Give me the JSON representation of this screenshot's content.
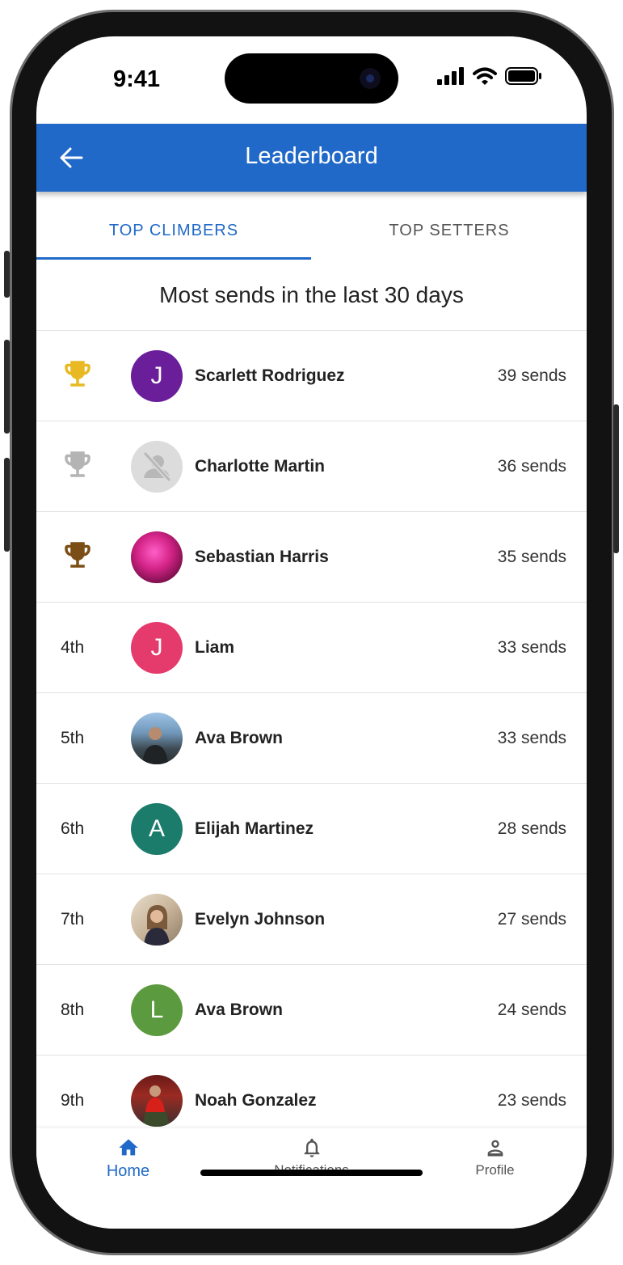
{
  "status_bar": {
    "time": "9:41"
  },
  "app_bar": {
    "title": "Leaderboard",
    "back_icon": "arrow-left-icon"
  },
  "tabs": [
    {
      "label": "TOP CLIMBERS",
      "selected": true
    },
    {
      "label": "TOP SETTERS",
      "selected": false
    }
  ],
  "subtitle": "Most sends in the last 30 days",
  "leaderboard": [
    {
      "rank": "",
      "trophy": "gold",
      "avatar": {
        "type": "initial",
        "initial": "J",
        "color": "#6a1e9a"
      },
      "name": "Scarlett Rodriguez",
      "sends": "39 sends"
    },
    {
      "rank": "",
      "trophy": "silver",
      "avatar": {
        "type": "placeholder",
        "color": "#dcdcdc"
      },
      "name": "Charlotte Martin",
      "sends": "36 sends"
    },
    {
      "rank": "",
      "trophy": "bronze",
      "avatar": {
        "type": "photo",
        "color": "#c2186e"
      },
      "name": "Sebastian Harris",
      "sends": "35 sends"
    },
    {
      "rank": "4th",
      "trophy": "",
      "avatar": {
        "type": "initial",
        "initial": "J",
        "color": "#e53a6c"
      },
      "name": "Liam",
      "sends": "33 sends"
    },
    {
      "rank": "5th",
      "trophy": "",
      "avatar": {
        "type": "photo",
        "color": "#6b88a3"
      },
      "name": "Ava Brown",
      "sends": "33 sends"
    },
    {
      "rank": "6th",
      "trophy": "",
      "avatar": {
        "type": "initial",
        "initial": "A",
        "color": "#1c7c6c"
      },
      "name": "Elijah Martinez",
      "sends": "28 sends"
    },
    {
      "rank": "7th",
      "trophy": "",
      "avatar": {
        "type": "photo",
        "color": "#b9a58c"
      },
      "name": "Evelyn Johnson",
      "sends": "27 sends"
    },
    {
      "rank": "8th",
      "trophy": "",
      "avatar": {
        "type": "initial",
        "initial": "L",
        "color": "#5b9a3e"
      },
      "name": "Ava Brown",
      "sends": "24 sends"
    },
    {
      "rank": "9th",
      "trophy": "",
      "avatar": {
        "type": "photo",
        "color": "#8a2a22"
      },
      "name": "Noah Gonzalez",
      "sends": "23 sends"
    }
  ],
  "trophy_colors": {
    "gold": "#e8b923",
    "silver": "#b4b4b4",
    "bronze": "#7a4e14"
  },
  "bottom_nav": [
    {
      "label": "Home",
      "icon": "home-icon",
      "active": true
    },
    {
      "label": "Notifications",
      "icon": "bell-icon",
      "active": false
    },
    {
      "label": "Profile",
      "icon": "person-icon",
      "active": false
    }
  ],
  "colors": {
    "primary": "#2169c8",
    "inactive": "#555555"
  }
}
